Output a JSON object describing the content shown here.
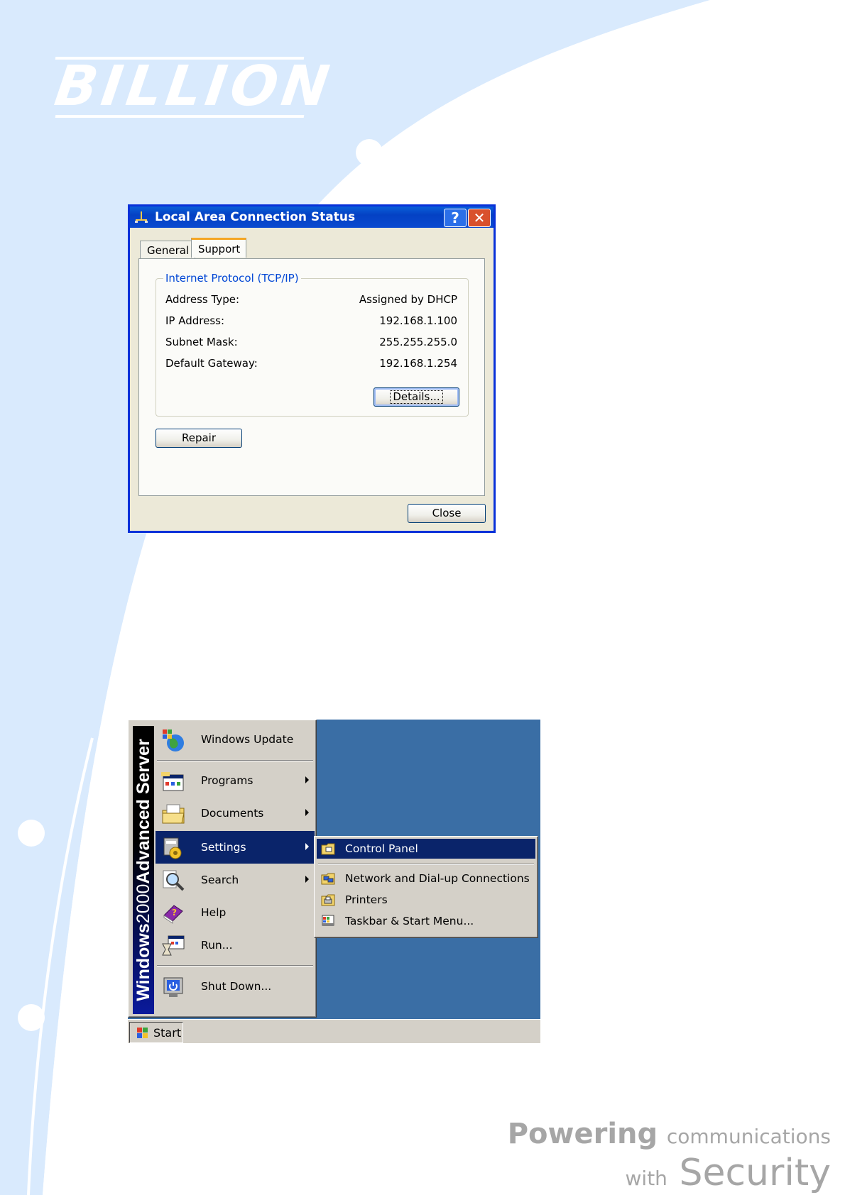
{
  "brand": {
    "logo": "BILLION",
    "slogan_part1_bold": "Powering",
    "slogan_part1_rest": "communications",
    "slogan_part2_small": "with",
    "slogan_part2_large": "Security"
  },
  "status_dialog": {
    "title": "Local Area Connection Status",
    "title_icon": "network-connection-icon",
    "help_label": "?",
    "close_glyph": "✕",
    "tabs": [
      "General",
      "Support"
    ],
    "active_tab": "Support",
    "group_title": "Internet Protocol (TCP/IP)",
    "rows": [
      {
        "label": "Address Type:",
        "value": "Assigned by DHCP"
      },
      {
        "label": "IP Address:",
        "value": "192.168.1.100"
      },
      {
        "label": "Subnet Mask:",
        "value": "255.255.255.0"
      },
      {
        "label": "Default Gateway:",
        "value": "192.168.1.254"
      }
    ],
    "details_button": "Details...",
    "repair_button": "Repair",
    "close_button": "Close"
  },
  "start_menu": {
    "banner_bold_1": "Windows",
    "banner_light": "2000",
    "banner_bold_2": "Advanced Server",
    "items": [
      {
        "label": "Windows Update",
        "icon": "windows-update-icon",
        "submenu": false
      },
      {
        "label": "Programs",
        "icon": "programs-icon",
        "submenu": true
      },
      {
        "label": "Documents",
        "icon": "documents-folder-icon",
        "submenu": true
      },
      {
        "label": "Settings",
        "icon": "settings-icon",
        "submenu": true,
        "selected": true
      },
      {
        "label": "Search",
        "icon": "search-icon",
        "submenu": true
      },
      {
        "label": "Help",
        "icon": "help-book-icon",
        "submenu": false
      },
      {
        "label": "Run...",
        "icon": "run-icon",
        "submenu": false
      },
      {
        "label": "Shut Down...",
        "icon": "shut-down-icon",
        "submenu": false
      }
    ],
    "settings_submenu": [
      {
        "label": "Control Panel",
        "icon": "control-panel-icon",
        "selected": true
      },
      {
        "label": "Network and Dial-up Connections",
        "icon": "network-connections-icon"
      },
      {
        "label": "Printers",
        "icon": "printers-icon"
      },
      {
        "label": "Taskbar & Start Menu...",
        "icon": "taskbar-icon"
      }
    ],
    "start_button": "Start"
  },
  "colors": {
    "page_swoosh": "#d9eafd",
    "xp_title_blue": "#0a4ad0",
    "desktop_blue": "#3a6ea5",
    "menu_highlight": "#0a246a"
  }
}
